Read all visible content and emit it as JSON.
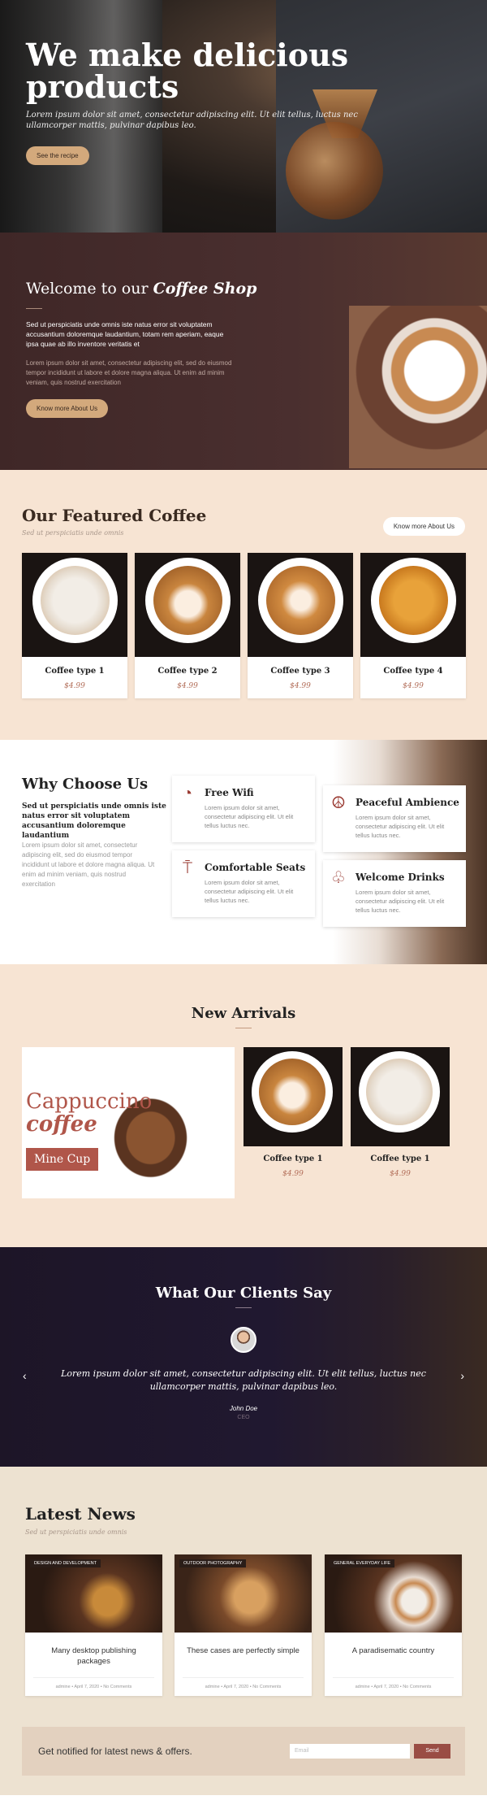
{
  "hero": {
    "title_line1": "We make delicious",
    "title_line2": "products",
    "text": "Lorem ipsum dolor sit amet, consectetur adipiscing elit. Ut elit tellus, luctus nec ullamcorper mattis, pulvinar dapibus leo.",
    "button": "See the recipe"
  },
  "welcome": {
    "title_prefix": "Welcome to our",
    "title_emph": "Coffee Shop",
    "lead": "Sed ut perspiciatis unde omnis iste natus error sit voluptatem accusantium doloremque laudantium, totam rem aperiam, eaque ipsa quae ab illo inventore veritatis et",
    "body": "Lorem ipsum dolor sit amet, consectetur adipiscing elit, sed do eiusmod tempor incididunt ut labore et dolore magna aliqua. Ut enim ad minim veniam, quis nostrud exercitation",
    "button": "Know more About Us"
  },
  "featured": {
    "title": "Our Featured Coffee",
    "subtitle": "Sed ut perspiciatis unde omnis",
    "button": "Know more About Us",
    "items": [
      {
        "name": "Coffee type 1",
        "price": "$4.99"
      },
      {
        "name": "Coffee type 2",
        "price": "$4.99"
      },
      {
        "name": "Coffee type 3",
        "price": "$4.99"
      },
      {
        "name": "Coffee type 4",
        "price": "$4.99"
      }
    ]
  },
  "why": {
    "title": "Why Choose Us",
    "lead": "Sed ut perspiciatis unde omnis iste natus error sit voluptatem accusantium doloremque laudantium",
    "body": "Lorem ipsum dolor sit amet, consectetur adipiscing elit, sed do eiusmod tempor incididunt ut labore et dolore magna aliqua. Ut enim ad minim veniam, quis nostrud exercitation",
    "features": [
      {
        "title": "Free Wifi",
        "text": "Lorem ipsum dolor sit amet, consectetur adipiscing elit. Ut elit tellus luctus nec.",
        "icon": "wifi-icon"
      },
      {
        "title": "Peaceful Ambience",
        "text": "Lorem ipsum dolor sit amet, consectetur adipiscing elit. Ut elit tellus luctus nec.",
        "icon": "peace-icon"
      },
      {
        "title": "Comfortable Seats",
        "text": "Lorem ipsum dolor sit amet, consectetur adipiscing elit. Ut elit tellus luctus nec.",
        "icon": "chair-icon"
      },
      {
        "title": "Welcome Drinks",
        "text": "Lorem ipsum dolor sit amet, consectetur adipiscing elit. Ut elit tellus luctus nec.",
        "icon": "glasses-icon"
      }
    ]
  },
  "arrivals": {
    "title": "New Arrivals",
    "feature_line1": "Cappuccino",
    "feature_line2": "coffee",
    "feature_button": "Mine Cup",
    "items": [
      {
        "name": "Coffee type 1",
        "price": "$4.99"
      },
      {
        "name": "Coffee type 1",
        "price": "$4.99"
      }
    ]
  },
  "clients": {
    "title": "What Our Clients Say",
    "quote": "Lorem ipsum dolor sit amet, consectetur adipiscing elit. Ut elit tellus, luctus nec ullamcorper mattis, pulvinar dapibus leo.",
    "name": "John Doe",
    "role": "CEO"
  },
  "news": {
    "title": "Latest News",
    "subtitle": "Sed ut perspiciatis unde omnis",
    "items": [
      {
        "tag": "DESIGN AND DEVELOPMENT",
        "title": "Many desktop publishing packages",
        "meta": "admine  •  April 7, 2020  •  No Comments"
      },
      {
        "tag": "OUTDOOR PHOTOGRAPHY",
        "title": "These cases are perfectly simple",
        "meta": "admine  •  April 7, 2020  •  No Comments"
      },
      {
        "tag": "GENERAL EVERYDAY LIFE",
        "title": "A paradisematic country",
        "meta": "admine  •  April 7, 2020  •  No Comments"
      }
    ]
  },
  "newsletter": {
    "text": "Get notified for latest news & offers.",
    "placeholder": "Email",
    "button": "Send"
  },
  "colors": {
    "accent": "#b0564a",
    "tan": "#d3a97c",
    "cream": "#f7e4d3"
  }
}
